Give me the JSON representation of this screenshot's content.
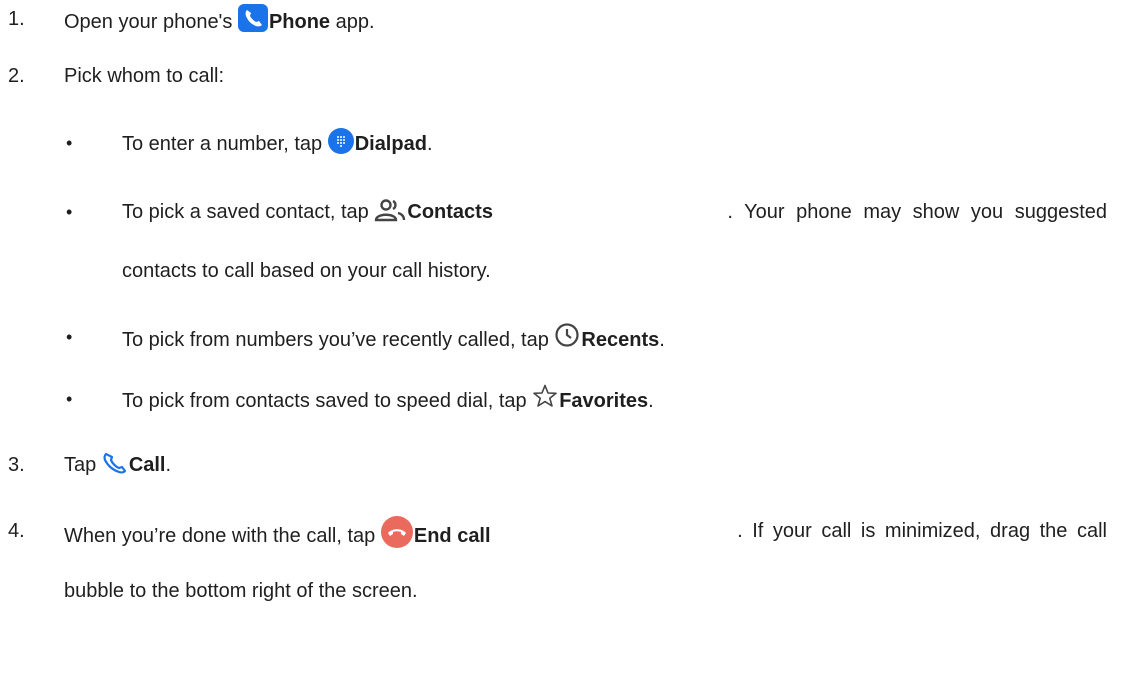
{
  "steps": [
    {
      "number": "1.",
      "pre": "Open your phone's ",
      "bold": "Phone",
      "post": " app."
    },
    {
      "number": "2.",
      "text": "Pick whom to call:"
    },
    {
      "number": "3.",
      "pre": "Tap ",
      "bold": "Call",
      "post": "."
    },
    {
      "number": "4.",
      "pre": "When you’re done with the call, tap ",
      "bold": "End call",
      "post": ". If your call is minimized, drag the call",
      "cont": "bubble to the bottom right of the screen."
    }
  ],
  "bullets": [
    {
      "symbol": "•",
      "pre": "To enter a number, tap ",
      "bold": "Dialpad",
      "post": "."
    },
    {
      "symbol": "•",
      "pre": "To pick a saved contact, tap ",
      "bold": "Contacts",
      "post": ". Your phone may show you suggested",
      "cont": "contacts to call based on your call history."
    },
    {
      "symbol": "•",
      "pre": "To pick from numbers you’ve recently called, tap ",
      "bold": "Recents",
      "post": "."
    },
    {
      "symbol": "•",
      "pre": "To pick from contacts saved to speed dial, tap ",
      "bold": "Favorites",
      "post": "."
    }
  ],
  "icons": {
    "phone_app": "phone-app-icon",
    "dialpad": "dialpad-icon",
    "contacts": "contacts-icon",
    "recents": "clock-icon",
    "favorites": "star-icon",
    "call": "call-icon",
    "end_call": "end-call-icon"
  },
  "colors": {
    "blue": "#1a73e8",
    "red": "#ea6a5e",
    "gray": "#444444"
  }
}
